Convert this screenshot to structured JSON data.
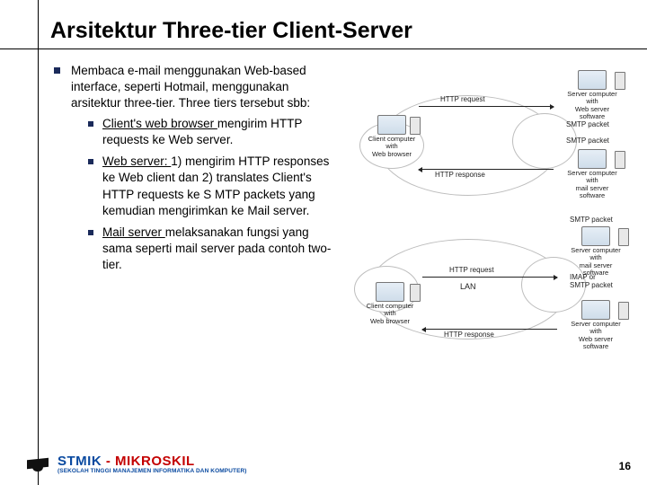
{
  "title": "Arsitektur Three-tier Client-Server",
  "intro": "Membaca e-mail menggunakan Web-based interface, seperti Hotmail, menggunakan arsitektur three-tier. Three tiers tersebut sbb:",
  "points": {
    "p1_lead": "Client's web browser ",
    "p1_rest": "mengirim HTTP requests ke Web server.",
    "p2_lead": "Web server: ",
    "p2_rest": "1) mengirim HTTP responses ke Web client dan 2) translates Client's HTTP requests ke S MTP packets yang kemudian mengirimkan ke Mail server.",
    "p3_lead": "Mail server ",
    "p3_rest": "melaksanakan fungsi yang sama seperti mail server pada contoh two-tier."
  },
  "diagram": {
    "top": {
      "client": "Client computer with\nWeb browser",
      "web_server": "Server computer with\nWeb server\nsoftware",
      "mail_server": "Server computer with\nmail server\nsoftware",
      "http_request": "HTTP request",
      "http_response": "HTTP response",
      "smtp_packet": "SMTP packet",
      "smtp_packet2": "SMTP packet"
    },
    "bottom": {
      "client": "Client computer with\nWeb browser",
      "web_server": "Server computer with\nWeb server\nsoftware",
      "mail_server": "Server computer with\nmail server\nsoftware",
      "lan": "LAN",
      "http_request": "HTTP request",
      "http_response": "HTTP response",
      "smtp_packet": "SMTP packet",
      "imap": "IMAP or\nSMTP packet"
    }
  },
  "footer": {
    "brand_stmik": "STMIK",
    "brand_dash": " - ",
    "brand_mk": "MIKROSKIL",
    "brand_sub": "(SEKOLAH TINGGI MANAJEMEN INFORMATIKA DAN KOMPUTER)",
    "page": "16"
  }
}
